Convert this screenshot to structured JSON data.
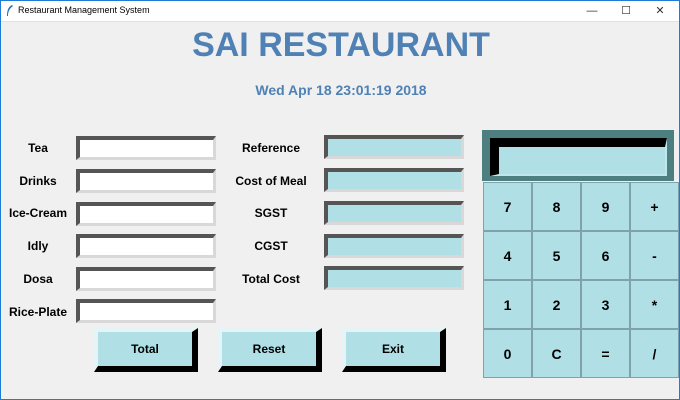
{
  "window": {
    "title": "Restaurant Management System",
    "controls": {
      "minimize": "—",
      "maximize": "☐",
      "close": "✕"
    }
  },
  "header": {
    "title": "SAI RESTAURANT",
    "datetime": "Wed Apr 18 23:01:19 2018"
  },
  "order": {
    "items": [
      {
        "label": "Tea",
        "value": ""
      },
      {
        "label": "Drinks",
        "value": ""
      },
      {
        "label": "Ice-Cream",
        "value": ""
      },
      {
        "label": "Idly",
        "value": ""
      },
      {
        "label": "Dosa",
        "value": ""
      },
      {
        "label": "Rice-Plate",
        "value": ""
      }
    ]
  },
  "bill": {
    "fields": [
      {
        "label": "Reference",
        "value": ""
      },
      {
        "label": "Cost of Meal",
        "value": ""
      },
      {
        "label": "SGST",
        "value": ""
      },
      {
        "label": "CGST",
        "value": ""
      },
      {
        "label": "Total Cost",
        "value": ""
      }
    ]
  },
  "actions": {
    "total": "Total",
    "reset": "Reset",
    "exit": "Exit"
  },
  "calculator": {
    "display": "",
    "buttons": [
      [
        "7",
        "8",
        "9",
        "+"
      ],
      [
        "4",
        "5",
        "6",
        "-"
      ],
      [
        "1",
        "2",
        "3",
        "*"
      ],
      [
        "0",
        "C",
        "=",
        "/"
      ]
    ]
  },
  "colors": {
    "accent": "#4f81b5",
    "field_blue": "#b0dfe6",
    "calc_frame": "#4d7f81",
    "window_border": "#1e7bd6"
  },
  "icons": [
    "feather-icon",
    "minimize-icon",
    "maximize-icon",
    "close-icon"
  ]
}
